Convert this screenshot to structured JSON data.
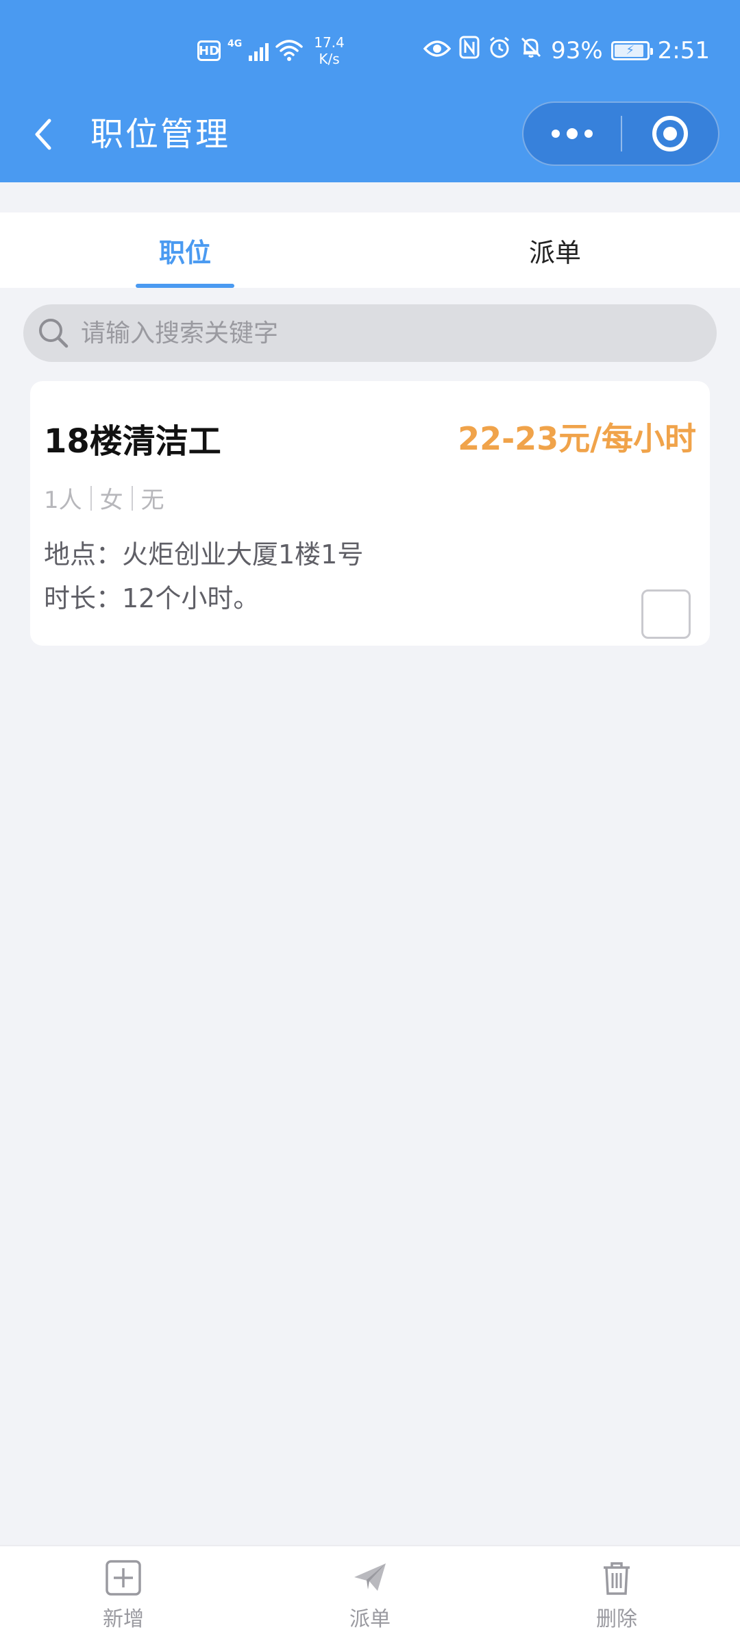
{
  "status_bar": {
    "hd": "HD",
    "network": "4G",
    "speed_value": "17.4",
    "speed_unit": "K/s",
    "battery_percent": "93%",
    "time": "2:51"
  },
  "nav": {
    "title": "职位管理"
  },
  "tabs": [
    {
      "label": "职位",
      "active": true
    },
    {
      "label": "派单",
      "active": false
    }
  ],
  "search": {
    "placeholder": "请输入搜索关键字",
    "value": ""
  },
  "jobs": [
    {
      "title": "18楼清洁工",
      "salary": "22-23元/每小时",
      "meta": [
        "1人",
        "女",
        "无"
      ],
      "location": "地点：火炬创业大厦1楼1号",
      "duration": "时长：12个小时。",
      "checked": false
    }
  ],
  "bottom_bar": {
    "add_label": "新增",
    "dispatch_label": "派单",
    "delete_label": "删除"
  },
  "colors": {
    "primary": "#4a9af1",
    "salary": "#f0a34a",
    "background": "#f2f3f7"
  },
  "icons": [
    "back-icon",
    "more-icon",
    "close-target-icon",
    "search-icon",
    "add-icon",
    "send-icon",
    "trash-icon",
    "eye-icon",
    "nfc-icon",
    "alarm-icon",
    "mute-bell-icon",
    "wifi-icon",
    "signal-icon",
    "battery-icon"
  ]
}
